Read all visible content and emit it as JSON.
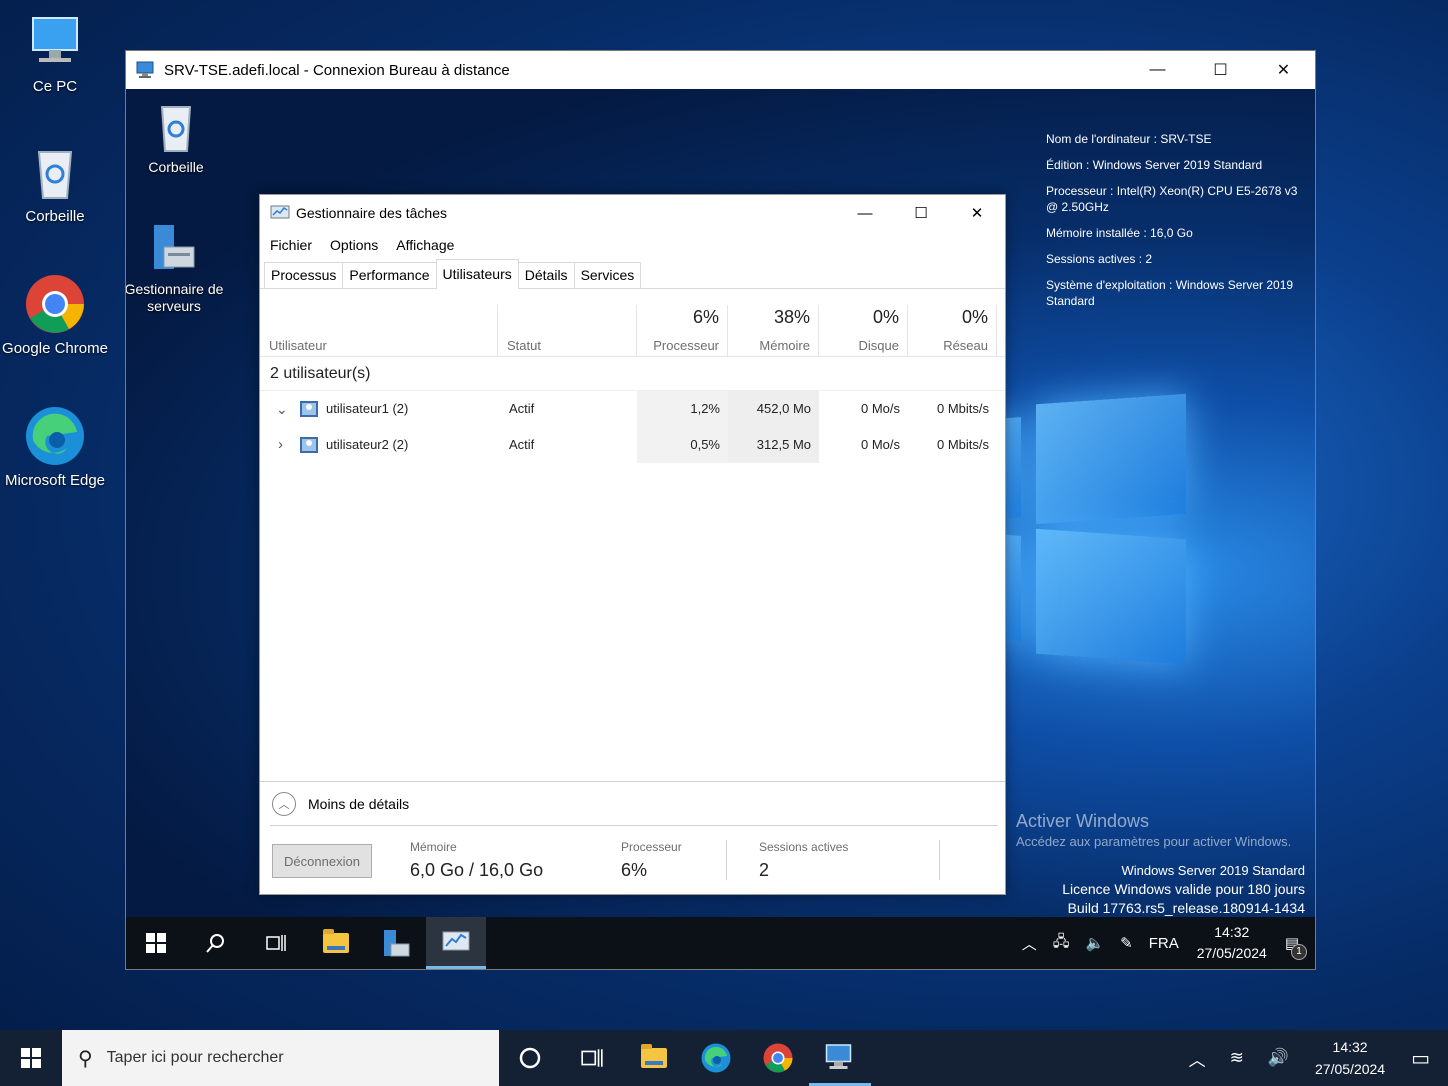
{
  "host_desktop": {
    "icons": [
      {
        "label": "Ce PC"
      },
      {
        "label": "Corbeille"
      },
      {
        "label": "Google Chrome"
      },
      {
        "label": "Microsoft Edge"
      }
    ]
  },
  "rdp_window": {
    "title": "SRV-TSE.adefi.local - Connexion Bureau à distance",
    "controls": {
      "minimize": "—",
      "maximize": "☐",
      "close": "✕"
    }
  },
  "remote_desktop": {
    "icons": [
      {
        "label": "Corbeille"
      },
      {
        "label": "Gestionnaire de serveurs"
      }
    ],
    "sysinfo": [
      "Nom de l'ordinateur : SRV-TSE",
      "Édition : Windows Server 2019 Standard",
      "Processeur : Intel(R) Xeon(R) CPU E5-2678 v3 @ 2.50GHz",
      "Mémoire installée : 16,0 Go",
      "Sessions actives : 2",
      "Système d'exploitation : Windows Server 2019 Standard"
    ],
    "activate": {
      "title": "Activer Windows",
      "subtitle": "Accédez aux paramètres pour activer Windows."
    },
    "watermark": {
      "line1": "Windows Server 2019 Standard",
      "line2": "Licence Windows valide pour 180 jours",
      "line3": "Build 17763.rs5_release.180914-1434"
    },
    "taskbar": {
      "language": "FRA",
      "time": "14:32",
      "date": "27/05/2024",
      "notification_count": "1"
    }
  },
  "task_manager": {
    "title": "Gestionnaire des tâches",
    "menu": [
      "Fichier",
      "Options",
      "Affichage"
    ],
    "tabs": [
      "Processus",
      "Performance",
      "Utilisateurs",
      "Détails",
      "Services"
    ],
    "active_tab": "Utilisateurs",
    "columns": {
      "user": "Utilisateur",
      "status": "Statut",
      "cpu": {
        "pct": "6%",
        "name": "Processeur"
      },
      "mem": {
        "pct": "38%",
        "name": "Mémoire"
      },
      "disk": {
        "pct": "0%",
        "name": "Disque"
      },
      "net": {
        "pct": "0%",
        "name": "Réseau"
      }
    },
    "group_label": "2 utilisateur(s)",
    "rows": [
      {
        "expand": "⌄",
        "name": "utilisateur1 (2)",
        "status": "Actif",
        "cpu": "1,2%",
        "mem": "452,0 Mo",
        "disk": "0 Mo/s",
        "net": "0 Mbits/s"
      },
      {
        "expand": "›",
        "name": "utilisateur2 (2)",
        "status": "Actif",
        "cpu": "0,5%",
        "mem": "312,5 Mo",
        "disk": "0 Mo/s",
        "net": "0 Mbits/s"
      }
    ],
    "fewer_details": "Moins de détails",
    "disconnect_button": "Déconnexion",
    "footer": {
      "memory_label": "Mémoire",
      "memory_value": "6,0 Go / 16,0 Go",
      "cpu_label": "Processeur",
      "cpu_value": "6%",
      "sessions_label": "Sessions actives",
      "sessions_value": "2"
    }
  },
  "host_taskbar": {
    "search_placeholder": "Taper ici pour rechercher",
    "time": "14:32",
    "date": "27/05/2024"
  },
  "colors": {
    "accent": "#0078d7",
    "desktop_bg": "#0b3f8c",
    "taskbar": "#142033"
  }
}
